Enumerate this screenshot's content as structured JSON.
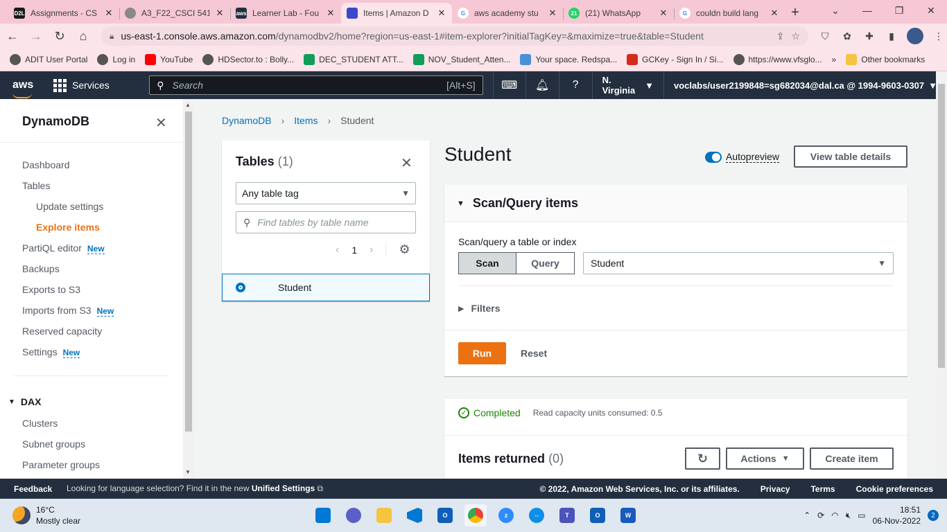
{
  "browser": {
    "tabs": [
      {
        "title": "Assignments - CS",
        "favicon": "D2L",
        "color": "#1a1a1a"
      },
      {
        "title": "A3_F22_CSCI 541",
        "favicon": "globe-icon",
        "color": "#666666"
      },
      {
        "title": "Learner Lab - Fou",
        "favicon": "aws",
        "color": "#232f3e"
      },
      {
        "title": "Items | Amazon D",
        "favicon": "dynamodb-icon",
        "color": "#3b48cc"
      },
      {
        "title": "aws academy stu",
        "favicon": "G",
        "color": "#4285f4"
      },
      {
        "title": "(21) WhatsApp",
        "favicon": "21",
        "color": "#25d366"
      },
      {
        "title": "couldn build lang",
        "favicon": "G",
        "color": "#4285f4"
      }
    ],
    "url_host": "us-east-1.console.aws.amazon.com",
    "url_path": "/dynamodbv2/home?region=us-east-1#item-explorer?initialTagKey=&maximize=true&table=Student",
    "bookmarks": [
      {
        "label": "ADIT User Portal",
        "color": "#555555"
      },
      {
        "label": "Log in",
        "color": "#555555"
      },
      {
        "label": "YouTube",
        "color": "#ff0000"
      },
      {
        "label": "HDSector.to : Bolly...",
        "color": "#555555"
      },
      {
        "label": "DEC_STUDENT ATT...",
        "color": "#0f9d58"
      },
      {
        "label": "NOV_Student_Atten...",
        "color": "#0f9d58"
      },
      {
        "label": "Your space. Redspa...",
        "color": "#4a90d9"
      },
      {
        "label": "GCKey - Sign In / Si...",
        "color": "#d52b1e"
      },
      {
        "label": "https://www.vfsglo...",
        "color": "#555555"
      }
    ],
    "bookmarks_overflow": "»",
    "other_bookmarks": "Other bookmarks"
  },
  "aws_nav": {
    "logo": "aws",
    "services": "Services",
    "search_placeholder": "Search",
    "search_shortcut": "[Alt+S]",
    "region": "N. Virginia",
    "account": "voclabs/user2199848=sg682034@dal.ca @ 1994-9603-0307"
  },
  "sidenav": {
    "title": "DynamoDB",
    "items": [
      {
        "label": "Dashboard",
        "badge": ""
      },
      {
        "label": "Tables",
        "badge": ""
      },
      {
        "label": "Update settings",
        "badge": ""
      },
      {
        "label": "Explore items",
        "badge": ""
      },
      {
        "label": "PartiQL editor",
        "badge": "New"
      },
      {
        "label": "Backups",
        "badge": ""
      },
      {
        "label": "Exports to S3",
        "badge": ""
      },
      {
        "label": "Imports from S3",
        "badge": "New"
      },
      {
        "label": "Reserved capacity",
        "badge": ""
      },
      {
        "label": "Settings",
        "badge": "New"
      }
    ],
    "dax_heading": "DAX",
    "dax_items": [
      "Clusters",
      "Subnet groups",
      "Parameter groups"
    ]
  },
  "breadcrumb": [
    "DynamoDB",
    "Items",
    "Student"
  ],
  "tables_panel": {
    "title": "Tables",
    "count": "(1)",
    "tag_select": "Any table tag",
    "search_placeholder": "Find tables by table name",
    "page": "1",
    "rows": [
      "Student"
    ]
  },
  "main": {
    "title": "Student",
    "autopreview": "Autopreview",
    "view_details": "View table details",
    "scan_header": "Scan/Query items",
    "scan_label": "Scan/query a table or index",
    "scan_btn": "Scan",
    "query_btn": "Query",
    "table_selected": "Student",
    "filters": "Filters",
    "run": "Run",
    "reset": "Reset",
    "status": "Completed",
    "rcu": "Read capacity units consumed: 0.5",
    "items_returned": "Items returned",
    "items_count": "(0)",
    "actions": "Actions",
    "create_item": "Create item"
  },
  "footer": {
    "feedback": "Feedback",
    "msg_prefix": "Looking for language selection? Find it in the new",
    "msg_link": "Unified Settings",
    "copyright": "© 2022, Amazon Web Services, Inc. or its affiliates.",
    "privacy": "Privacy",
    "terms": "Terms",
    "cookies": "Cookie preferences"
  },
  "taskbar": {
    "temp": "16°C",
    "weather": "Mostly clear",
    "time": "18:51",
    "date": "06-Nov-2022",
    "notifications": "2"
  },
  "colors": {
    "aws_nav": "#232f3e",
    "accent_orange": "#ec7211",
    "link_blue": "#0073bb",
    "success_green": "#1d8102"
  }
}
